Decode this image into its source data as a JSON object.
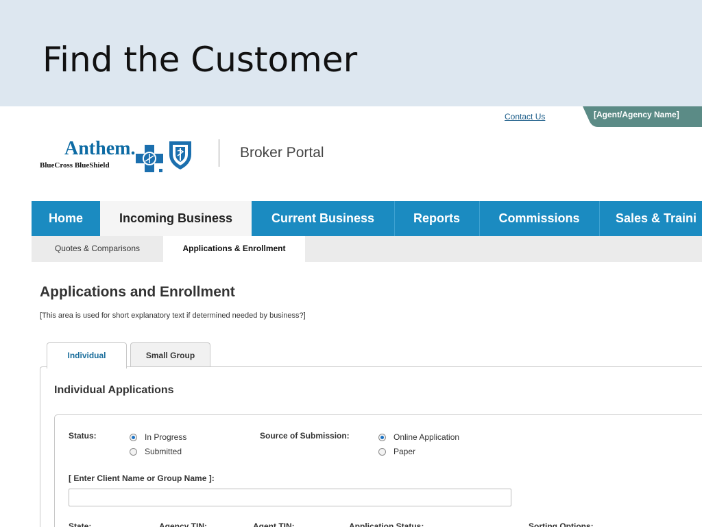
{
  "slide": {
    "title": "Find the Customer"
  },
  "header": {
    "contact_link": "Contact Us",
    "agent_tab": "[Agent/Agency Name]",
    "brand_name": "Anthem.",
    "brand_sub": "BlueCross BlueShield",
    "portal_title": "Broker Portal"
  },
  "colors": {
    "brand_blue": "#1b8bc1",
    "agent_tab_green": "#5b8b86",
    "slide_header_bg": "#dde7f0"
  },
  "main_nav": [
    {
      "label": "Home",
      "active": false
    },
    {
      "label": "Incoming Business",
      "active": true
    },
    {
      "label": "Current Business",
      "active": false
    },
    {
      "label": "Reports",
      "active": false
    },
    {
      "label": "Commissions",
      "active": false
    },
    {
      "label": "Sales & Traini",
      "active": false
    }
  ],
  "sub_nav": [
    {
      "label": "Quotes & Comparisons",
      "active": false
    },
    {
      "label": "Applications & Enrollment",
      "active": true
    }
  ],
  "page": {
    "heading": "Applications and Enrollment",
    "description": "[This area is used for short explanatory text if determined needed by business?]"
  },
  "tabs": [
    {
      "label": "Individual",
      "active": true
    },
    {
      "label": "Small Group",
      "active": false
    }
  ],
  "panel": {
    "title": "Individual Applications",
    "status": {
      "label": "Status:",
      "options": [
        {
          "label": "In Progress",
          "selected": true
        },
        {
          "label": "Submitted",
          "selected": false
        }
      ]
    },
    "source": {
      "label": "Source of Submission:",
      "options": [
        {
          "label": "Online Application",
          "selected": true
        },
        {
          "label": "Paper",
          "selected": false
        }
      ]
    },
    "client_search": {
      "label": "[ Enter Client Name or Group Name ]:",
      "value": ""
    },
    "bottom_labels": [
      "State:",
      "Agency TIN:",
      "Agent TIN:",
      "Application Status:",
      "Sorting Options:"
    ]
  }
}
